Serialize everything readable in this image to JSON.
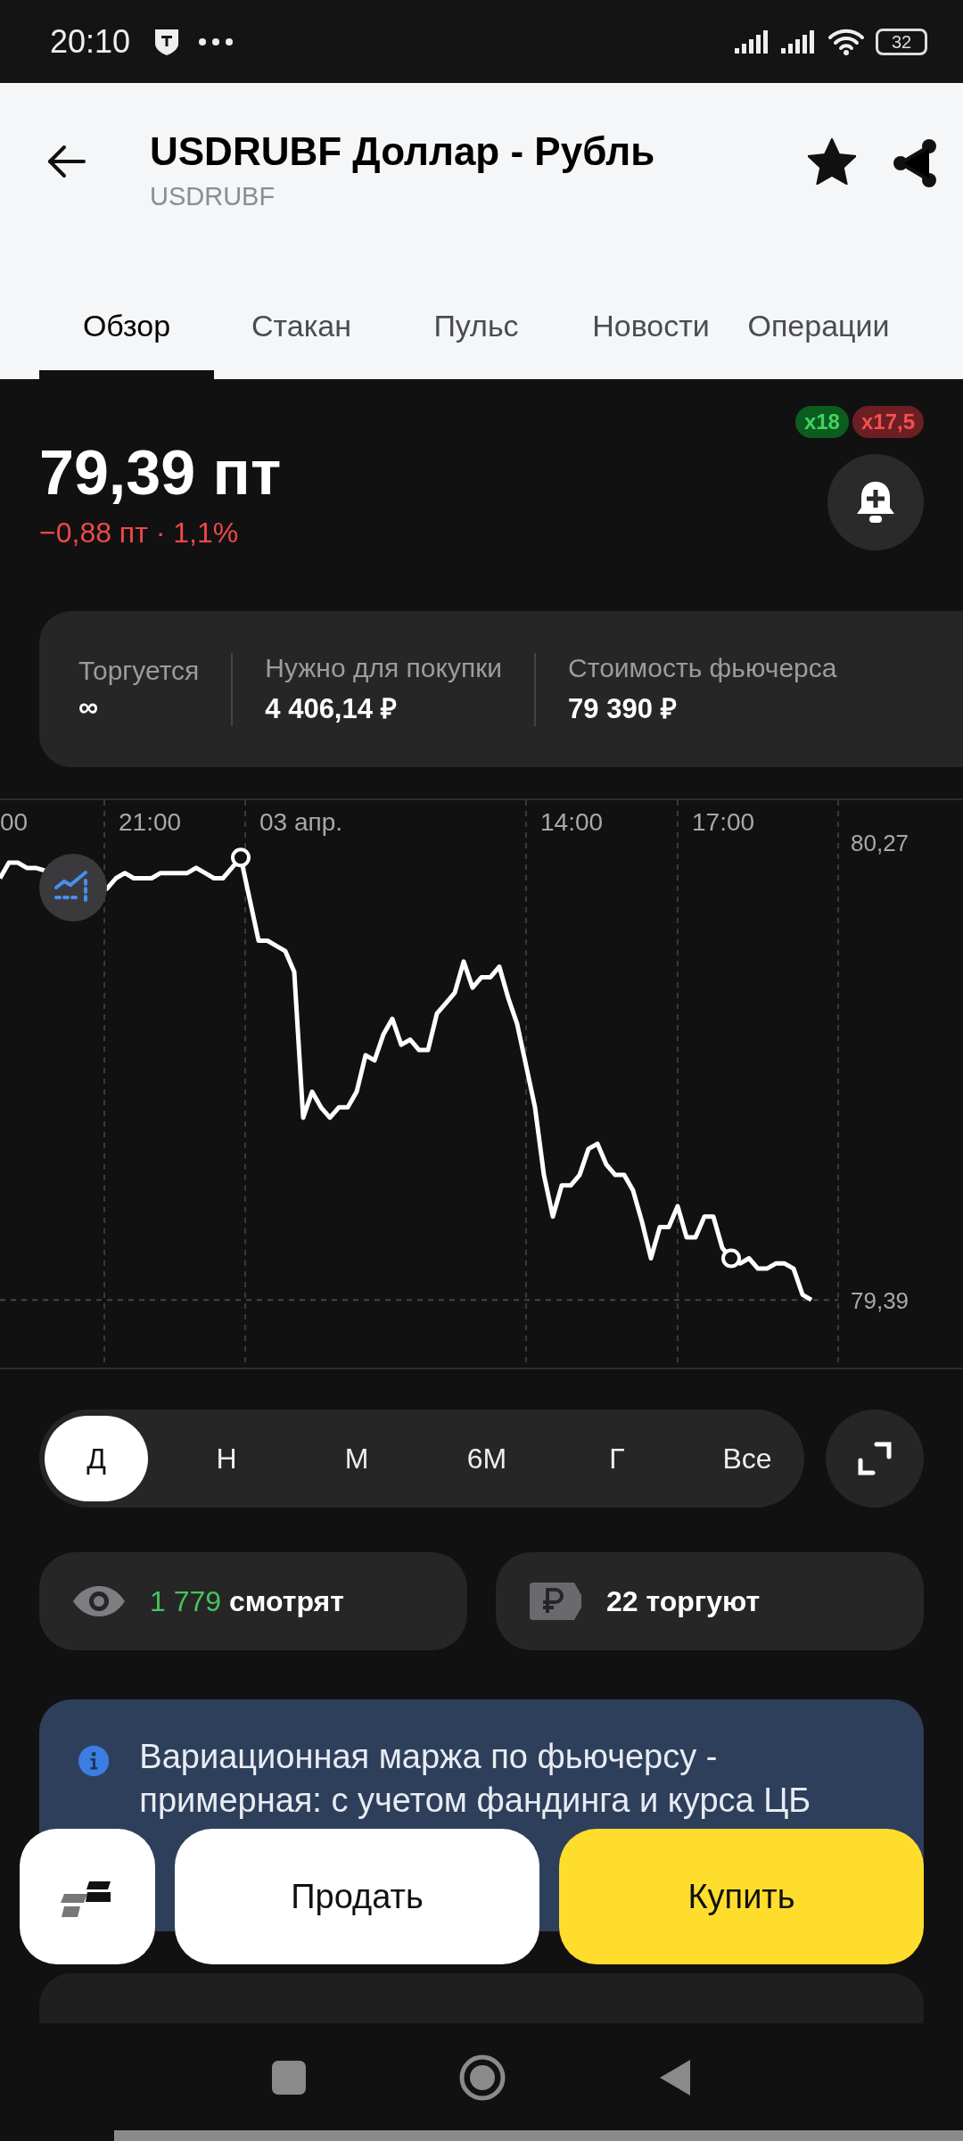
{
  "status_bar": {
    "time": "20:10",
    "battery": "32"
  },
  "header": {
    "title": "USDRUBF Доллар - Рубль",
    "subtitle": "USDRUBF",
    "favorite": true
  },
  "tabs": [
    {
      "label": "Обзор",
      "selected": true
    },
    {
      "label": "Стакан",
      "selected": false
    },
    {
      "label": "Пульс",
      "selected": false
    },
    {
      "label": "Новости",
      "selected": false
    },
    {
      "label": "Операции",
      "selected": false
    }
  ],
  "quote": {
    "price": "79,39 пт",
    "change": "−0,88 пт · 1,1%",
    "leverage_badges": [
      {
        "label": "x18",
        "color": "#0d5c1f"
      },
      {
        "label": "x17,5",
        "color": "#6b1f22"
      }
    ]
  },
  "stats": [
    {
      "label": "Торгуется",
      "value": "∞"
    },
    {
      "label": "Нужно для покупки",
      "value": "4 406,14 ₽"
    },
    {
      "label": "Стоимость фьючерса",
      "value": "79 390 ₽"
    }
  ],
  "chart": {
    "time_labels": [
      "00",
      "21:00",
      "03 апр.",
      "14:00",
      "17:00"
    ],
    "chart_data": {
      "type": "line",
      "ylim": [
        79.26,
        80.35
      ],
      "ref_lines": [
        {
          "axis": "y",
          "value": 79.39
        }
      ],
      "yticks": [
        {
          "value": 80.27,
          "label": "80,27"
        },
        {
          "value": 79.39,
          "label": "79,39"
        }
      ],
      "series": [
        {
          "color": "#ffffff",
          "values": [
            80.2,
            80.23,
            80.23,
            80.22,
            80.22,
            null,
            null,
            null,
            null,
            null,
            null,
            null,
            80.18,
            80.2,
            80.21,
            80.2,
            80.2,
            80.2,
            80.21,
            80.21,
            80.21,
            80.21,
            80.22,
            80.21,
            80.2,
            80.2,
            80.22,
            80.24,
            80.16,
            80.08,
            80.08,
            80.07,
            80.06,
            80.02,
            79.74,
            79.79,
            79.76,
            79.74,
            79.76,
            79.76,
            79.79,
            79.86,
            79.85,
            79.9,
            79.93,
            79.88,
            79.89,
            79.87,
            79.87,
            79.94,
            79.96,
            79.98,
            80.04,
            79.99,
            80.01,
            80.01,
            80.03,
            79.97,
            79.92,
            79.84,
            79.76,
            79.63,
            79.55,
            79.61,
            79.61,
            79.63,
            79.68,
            79.69,
            79.65,
            79.63,
            79.63,
            79.6,
            79.54,
            79.47,
            79.53,
            79.53,
            79.57,
            79.51,
            79.51,
            79.55,
            79.55,
            79.49,
            79.47,
            79.46,
            79.47,
            79.45,
            79.45,
            79.46,
            79.46,
            79.45,
            79.4,
            79.39
          ]
        }
      ]
    }
  },
  "periods": [
    {
      "label": "Д",
      "selected": true
    },
    {
      "label": "Н",
      "selected": false
    },
    {
      "label": "М",
      "selected": false
    },
    {
      "label": "6М",
      "selected": false
    },
    {
      "label": "Г",
      "selected": false
    },
    {
      "label": "Все",
      "selected": false
    }
  ],
  "activity": [
    {
      "kind": "watching",
      "count": "1 779",
      "label": "смотрят"
    },
    {
      "kind": "trading",
      "label": "22 торгуют"
    }
  ],
  "notice": {
    "text": "Вариационная маржа по фьючерсу - примерная: с учетом фандинга и курса ЦБ"
  },
  "actions": [
    {
      "kind": "logo"
    },
    {
      "kind": "sell",
      "label": "Продать"
    },
    {
      "kind": "buy",
      "label": "Купить"
    }
  ]
}
